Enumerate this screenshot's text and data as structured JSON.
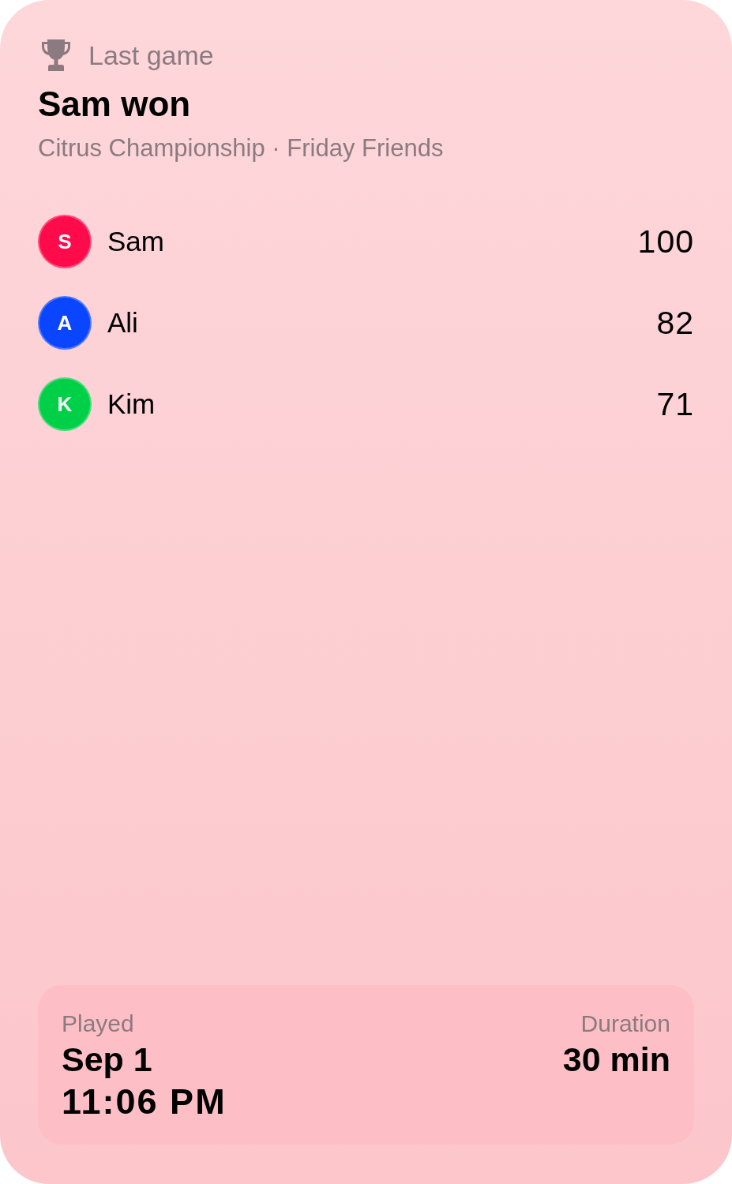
{
  "header": {
    "label": "Last game"
  },
  "title": "Sam won",
  "subtitle": "Citrus Championship · Friday Friends",
  "players": [
    {
      "initial": "S",
      "name": "Sam",
      "score": "100",
      "color": "#ff0a4a"
    },
    {
      "initial": "A",
      "name": "Ali",
      "score": "82",
      "color": "#0a45ff"
    },
    {
      "initial": "K",
      "name": "Kim",
      "score": "71",
      "color": "#00d048"
    }
  ],
  "footer": {
    "played": {
      "label": "Played",
      "date": "Sep 1",
      "time": "11:06 PM"
    },
    "duration": {
      "label": "Duration",
      "value": "30 min"
    }
  }
}
